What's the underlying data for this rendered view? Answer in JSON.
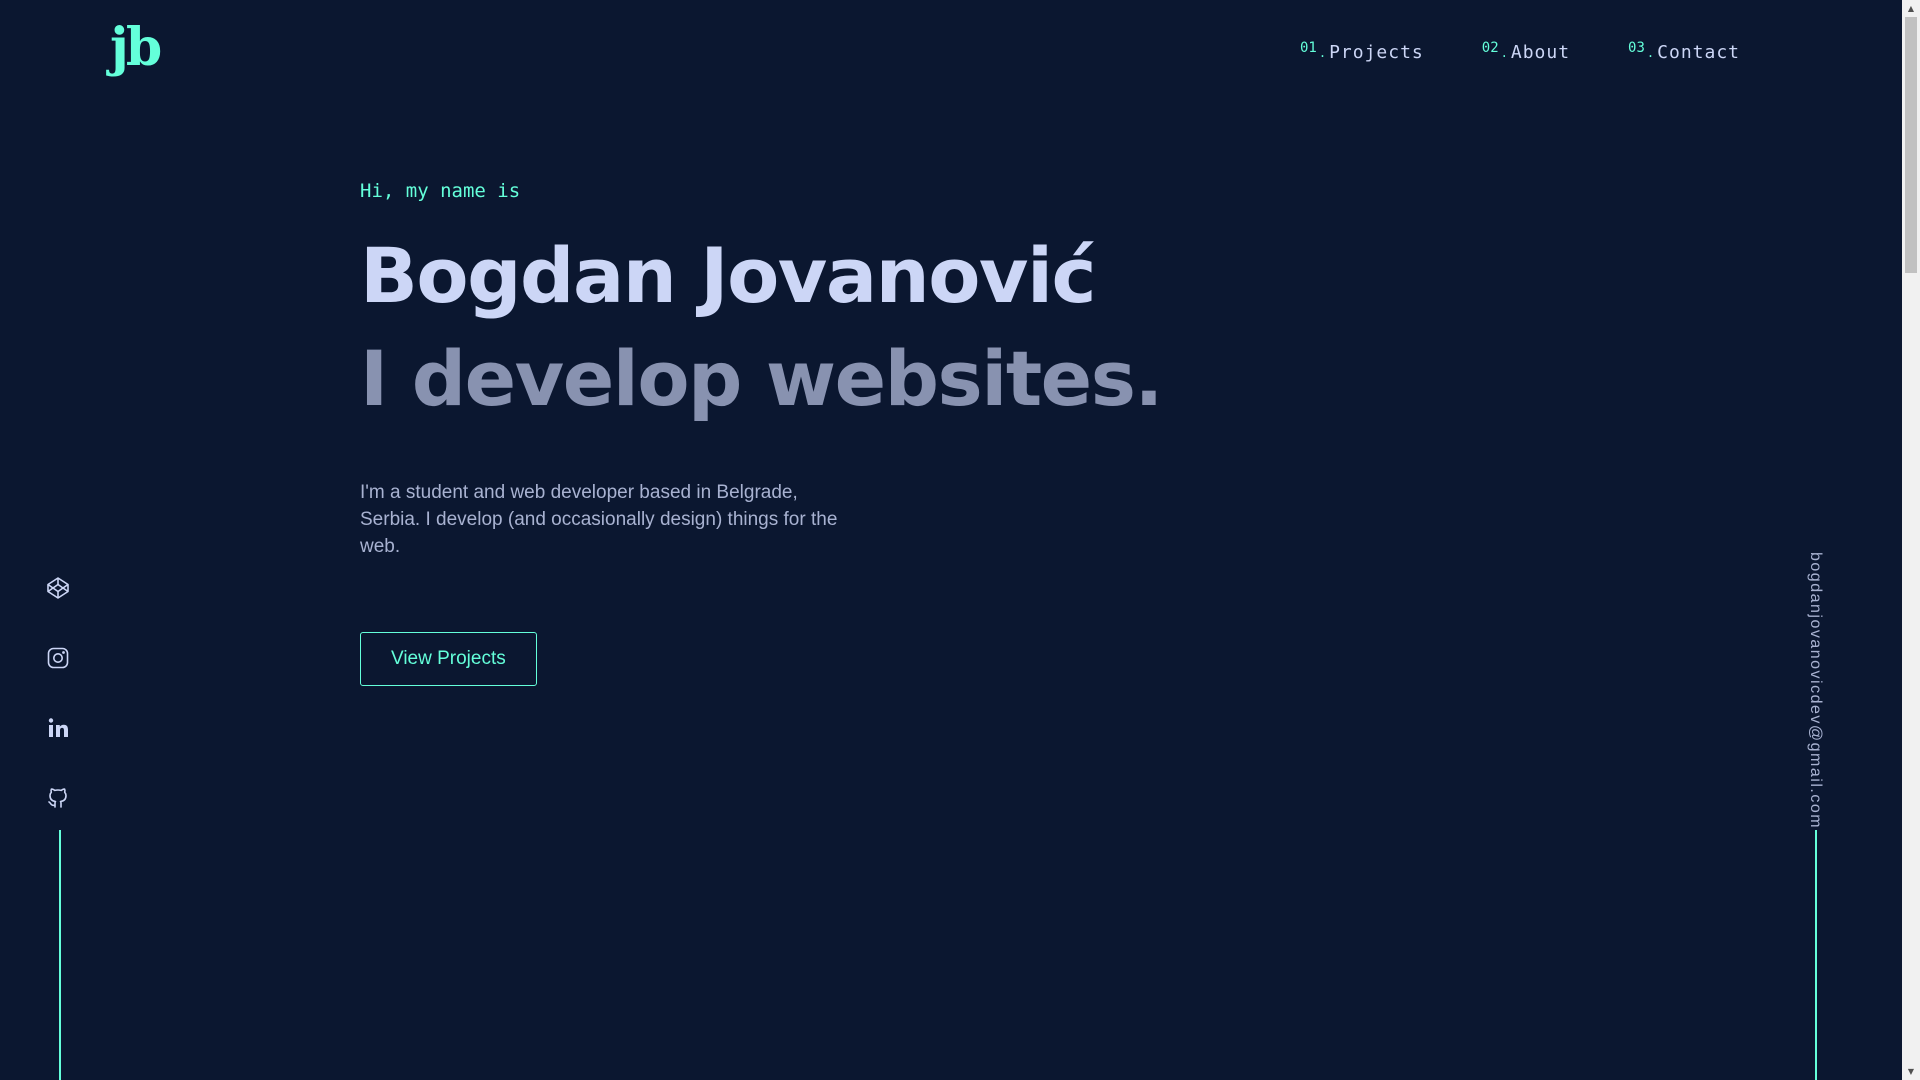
{
  "logo": {
    "text": "jb"
  },
  "nav": {
    "items": [
      {
        "num": "01",
        "label": "Projects"
      },
      {
        "num": "02",
        "label": "About"
      },
      {
        "num": "03",
        "label": "Contact"
      }
    ]
  },
  "hero": {
    "greeting": "Hi, my name is",
    "name": "Bogdan Jovanović",
    "tagline": "I develop websites.",
    "bio": "I'm a student and web developer based in Belgrade, Serbia. I develop (and occasionally design) things for the web.",
    "cta_label": "View Projects"
  },
  "social": {
    "icons": [
      "codepen-icon",
      "instagram-icon",
      "linkedin-icon",
      "github-icon"
    ]
  },
  "contact": {
    "email": "bogdanjovanovicdev@gmail.com"
  },
  "colors": {
    "background": "#0b1730",
    "accent": "#64ffda",
    "heading": "#ccd6f6",
    "muted": "#8892b0"
  }
}
